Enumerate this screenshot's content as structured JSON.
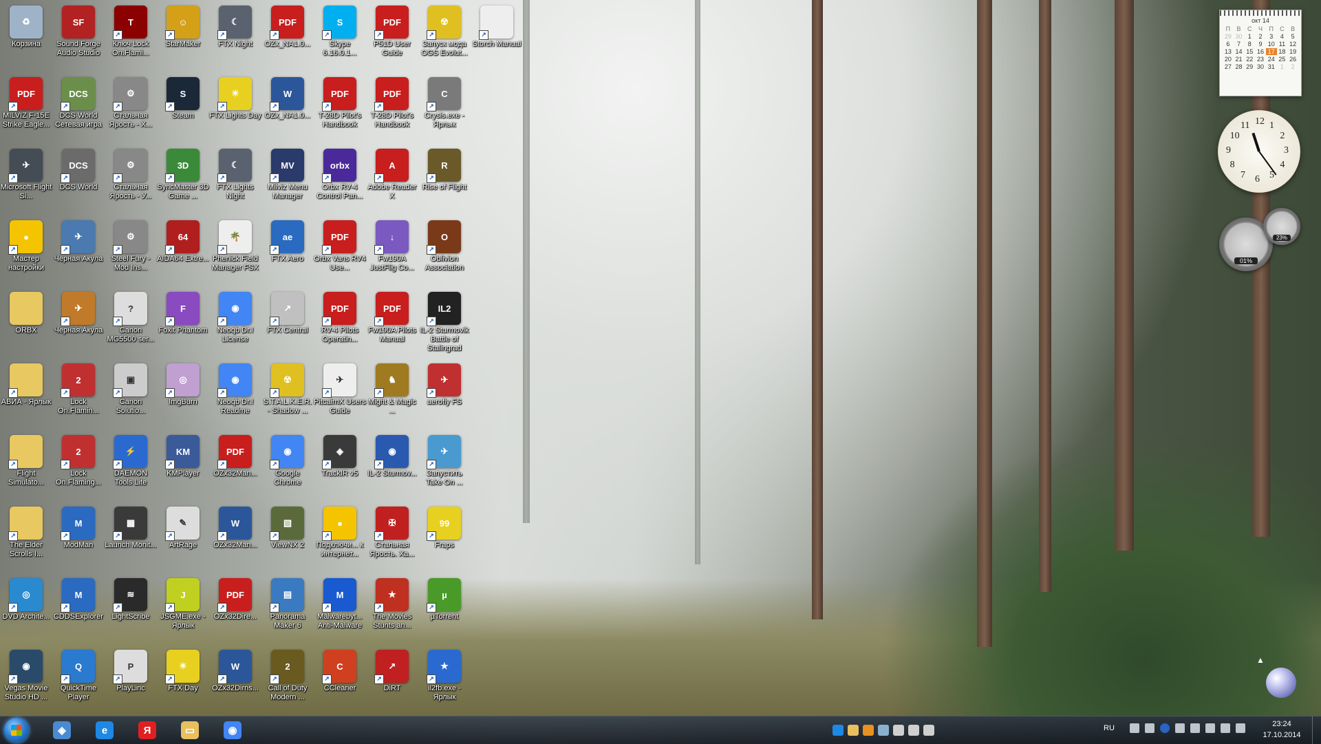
{
  "desktop": {
    "icons": [
      {
        "label": "Корзина",
        "icon": "recycle-bin-icon",
        "color": "#9fb3c8",
        "glyph": "♻",
        "shortcut": false
      },
      {
        "label": "Sound Forge Audio Studio",
        "icon": "sound-forge-icon",
        "color": "#b22222",
        "glyph": "SF",
        "shortcut": false
      },
      {
        "label": "Ключ Lock On.Flami...",
        "icon": "lock-on-icon",
        "color": "#8b0000",
        "glyph": "T",
        "shortcut": true
      },
      {
        "label": "StarMaker",
        "icon": "starmaker-icon",
        "color": "#d4a017",
        "glyph": "☺",
        "shortcut": true
      },
      {
        "label": "FTX Night",
        "icon": "ftx-night-icon",
        "color": "#5a6270",
        "glyph": "☾",
        "shortcut": true
      },
      {
        "label": "OZx_NA1.0...",
        "icon": "pdf-icon",
        "color": "#c81e1e",
        "glyph": "PDF",
        "shortcut": true
      },
      {
        "label": "Skype 6.16.0.1...",
        "icon": "skype-icon",
        "color": "#00aff0",
        "glyph": "S",
        "shortcut": true
      },
      {
        "label": "P51D User Guide",
        "icon": "pdf-icon",
        "color": "#c81e1e",
        "glyph": "PDF",
        "shortcut": true
      },
      {
        "label": "Запуск мода OGS Evolut...",
        "icon": "radiation-icon",
        "color": "#e0c020",
        "glyph": "☢",
        "shortcut": true
      },
      {
        "label": "Storch Manual",
        "icon": "document-icon",
        "color": "#eeeeee",
        "glyph": "",
        "shortcut": true
      },
      {
        "label": "MILVIZ F-15E Strike Eagle...",
        "icon": "pdf-icon",
        "color": "#c81e1e",
        "glyph": "PDF",
        "shortcut": true
      },
      {
        "label": "DCS World Сетевая игра",
        "icon": "dcs-icon",
        "color": "#6b8f4a",
        "glyph": "DCS",
        "shortcut": true
      },
      {
        "label": "Стальная Ярость - Х...",
        "icon": "gear-icon",
        "color": "#888888",
        "glyph": "⚙",
        "shortcut": true
      },
      {
        "label": "Steam",
        "icon": "steam-icon",
        "color": "#1b2838",
        "glyph": "S",
        "shortcut": true
      },
      {
        "label": "FTX Lights Day",
        "icon": "ftx-day-icon",
        "color": "#e8d020",
        "glyph": "☀",
        "shortcut": true
      },
      {
        "label": "OZx_NA1.0...",
        "icon": "word-icon",
        "color": "#2b579a",
        "glyph": "W",
        "shortcut": true
      },
      {
        "label": "T-28D Pilot's Handbook",
        "icon": "pdf-icon",
        "color": "#c81e1e",
        "glyph": "PDF",
        "shortcut": true
      },
      {
        "label": "T-28D Pilot's Handbook",
        "icon": "pdf-icon",
        "color": "#c81e1e",
        "glyph": "PDF",
        "shortcut": true
      },
      {
        "label": "Crysis.exe - Ярлык",
        "icon": "crysis-icon",
        "color": "#7a7a7a",
        "glyph": "C",
        "shortcut": true
      },
      {
        "label": "Microsoft Flight Si...",
        "icon": "airplane-icon",
        "color": "#444c55",
        "glyph": "✈",
        "shortcut": true
      },
      {
        "label": "DCS World",
        "icon": "dcs-icon",
        "color": "#6b6b6b",
        "glyph": "DCS",
        "shortcut": true
      },
      {
        "label": "Стальная Ярость - У...",
        "icon": "gear-icon",
        "color": "#888888",
        "glyph": "⚙",
        "shortcut": true
      },
      {
        "label": "SyncMaster 3D Game ...",
        "icon": "3d-icon",
        "color": "#3a8a3a",
        "glyph": "3D",
        "shortcut": true
      },
      {
        "label": "FTX Lights Night",
        "icon": "ftx-night-icon",
        "color": "#5a6270",
        "glyph": "☾",
        "shortcut": true
      },
      {
        "label": "Milviz Menu Manager",
        "icon": "milviz-icon",
        "color": "#2a3a6a",
        "glyph": "MV",
        "shortcut": true
      },
      {
        "label": "Orbx RV-4 Control Pan...",
        "icon": "orbx-icon",
        "color": "#4a2a9a",
        "glyph": "orbx",
        "shortcut": true
      },
      {
        "label": "Adobe Reader X",
        "icon": "adobe-reader-icon",
        "color": "#c81e1e",
        "glyph": "A",
        "shortcut": true
      },
      {
        "label": "Rise of Flight",
        "icon": "rise-of-flight-icon",
        "color": "#6a5a2a",
        "glyph": "R",
        "shortcut": true
      },
      {
        "label": "Мастер настройки",
        "icon": "beeline-icon",
        "color": "#f5c400",
        "glyph": "●",
        "shortcut": true
      },
      {
        "label": "Черная Акула",
        "icon": "black-shark-icon",
        "color": "#4a7ab0",
        "glyph": "✈",
        "shortcut": true
      },
      {
        "label": "Steel Fury - Mod Ins...",
        "icon": "gear-icon",
        "color": "#888888",
        "glyph": "⚙",
        "shortcut": true
      },
      {
        "label": "AIDA64 Extre...",
        "icon": "aida64-icon",
        "color": "#b01e1e",
        "glyph": "64",
        "shortcut": true
      },
      {
        "label": "Phenick Field Manager FSX",
        "icon": "palm-icon",
        "color": "#eeeeee",
        "glyph": "🌴",
        "shortcut": true
      },
      {
        "label": "FTX Aero",
        "icon": "ftx-aero-icon",
        "color": "#2a6ac0",
        "glyph": "ae",
        "shortcut": true
      },
      {
        "label": "Orbx Vans RV4 Use...",
        "icon": "pdf-icon",
        "color": "#c81e1e",
        "glyph": "PDF",
        "shortcut": true
      },
      {
        "label": "Fw190A JustFlig Co...",
        "icon": "installer-icon",
        "color": "#7a5ac0",
        "glyph": "↓",
        "shortcut": true
      },
      {
        "label": "Oblivion Association",
        "icon": "oblivion-icon",
        "color": "#7a3a1a",
        "glyph": "O",
        "shortcut": true
      },
      {
        "label": "ORBX",
        "icon": "folder-icon",
        "color": "#e8c860",
        "glyph": "",
        "shortcut": false
      },
      {
        "label": "Черная Акула",
        "icon": "black-shark-icon",
        "color": "#c07a2a",
        "glyph": "✈",
        "shortcut": true
      },
      {
        "label": "Canon MG5500 ser...",
        "icon": "help-icon",
        "color": "#dddddd",
        "glyph": "?",
        "shortcut": true
      },
      {
        "label": "Foxit Phantom",
        "icon": "foxit-icon",
        "color": "#8a4ac0",
        "glyph": "F",
        "shortcut": true
      },
      {
        "label": "Neoqb Dr.! License",
        "icon": "chrome-icon",
        "color": "#4285f4",
        "glyph": "◉",
        "shortcut": true
      },
      {
        "label": "FTX Central",
        "icon": "compass-icon",
        "color": "#c0c0c0",
        "glyph": "↗",
        "shortcut": true
      },
      {
        "label": "RV-4 Pilots Operatin...",
        "icon": "pdf-icon",
        "color": "#c81e1e",
        "glyph": "PDF",
        "shortcut": true
      },
      {
        "label": "Fw190A Pilots Manual",
        "icon": "pdf-icon",
        "color": "#c81e1e",
        "glyph": "PDF",
        "shortcut": true
      },
      {
        "label": "IL-2 Sturmovik Battle of Stalingrad",
        "icon": "il2-icon",
        "color": "#222222",
        "glyph": "IL2",
        "shortcut": true
      },
      {
        "label": "АВИА - Ярлык",
        "icon": "folder-icon",
        "color": "#e8c860",
        "glyph": "",
        "shortcut": true
      },
      {
        "label": "Lock On.Flamin...",
        "icon": "lock-on-flaming-icon",
        "color": "#c03030",
        "glyph": "2",
        "shortcut": true
      },
      {
        "label": "Canon Solutio...",
        "icon": "canon-icon",
        "color": "#cccccc",
        "glyph": "▣",
        "shortcut": true
      },
      {
        "label": "ImgBurn",
        "icon": "disc-icon",
        "color": "#c0a0d0",
        "glyph": "◎",
        "shortcut": true
      },
      {
        "label": "Neoqb Dr.! Readme",
        "icon": "chrome-icon",
        "color": "#4285f4",
        "glyph": "◉",
        "shortcut": true
      },
      {
        "label": "S.T.A.L.K.E.R. - Shadow ...",
        "icon": "radiation-icon",
        "color": "#e0c020",
        "glyph": "☢",
        "shortcut": true
      },
      {
        "label": "PitcairnX Users Guide",
        "icon": "document-icon",
        "color": "#eeeeee",
        "glyph": "✈",
        "shortcut": true
      },
      {
        "label": "Might & Magic ...",
        "icon": "griffin-icon",
        "color": "#a07a20",
        "glyph": "♞",
        "shortcut": true
      },
      {
        "label": "aerofly FS",
        "icon": "biplane-icon",
        "color": "#c03030",
        "glyph": "✈",
        "shortcut": true
      },
      {
        "label": "Flight Simulato...",
        "icon": "folder-icon",
        "color": "#e8c860",
        "glyph": "",
        "shortcut": true
      },
      {
        "label": "Lock On.Flaming...",
        "icon": "lock-on-flaming-icon",
        "color": "#c03030",
        "glyph": "2",
        "shortcut": true
      },
      {
        "label": "DAEMON Tools Lite",
        "icon": "daemon-tools-icon",
        "color": "#2a6ad0",
        "glyph": "⚡",
        "shortcut": true
      },
      {
        "label": "KMPlayer",
        "icon": "kmplayer-icon",
        "color": "#3a5a9a",
        "glyph": "KM",
        "shortcut": true
      },
      {
        "label": "OZx32Man...",
        "icon": "pdf-icon",
        "color": "#c81e1e",
        "glyph": "PDF",
        "shortcut": true
      },
      {
        "label": "Google Chrome",
        "icon": "chrome-icon",
        "color": "#4285f4",
        "glyph": "◉",
        "shortcut": true
      },
      {
        "label": "TrackIR v5",
        "icon": "trackir-icon",
        "color": "#3a3a3a",
        "glyph": "◈",
        "shortcut": true
      },
      {
        "label": "IL-2 Sturmov...",
        "icon": "roundel-icon",
        "color": "#2a5ab0",
        "glyph": "◉",
        "shortcut": true
      },
      {
        "label": "Запустить Take On ...",
        "icon": "take-on-icon",
        "color": "#4a9ad0",
        "glyph": "✈",
        "shortcut": true
      },
      {
        "label": "The Elder Scrolls I...",
        "icon": "folder-icon",
        "color": "#e8c860",
        "glyph": "",
        "shortcut": true
      },
      {
        "label": "ModMan",
        "icon": "modman-icon",
        "color": "#2a6ac0",
        "glyph": "M",
        "shortcut": true
      },
      {
        "label": "Launch Monit...",
        "icon": "launch-monitor-icon",
        "color": "#3a3a3a",
        "glyph": "▦",
        "shortcut": true
      },
      {
        "label": "ArtRage",
        "icon": "artrage-icon",
        "color": "#dddddd",
        "glyph": "✎",
        "shortcut": true
      },
      {
        "label": "OZx32Man...",
        "icon": "word-icon",
        "color": "#2b579a",
        "glyph": "W",
        "shortcut": true
      },
      {
        "label": "ViewNX 2",
        "icon": "viewnx-icon",
        "color": "#5a6a3a",
        "glyph": "▧",
        "shortcut": true
      },
      {
        "label": "Подключи... к интернет...",
        "icon": "beeline-icon",
        "color": "#f5c400",
        "glyph": "●",
        "shortcut": true
      },
      {
        "label": "Стальная Ярость. Ха...",
        "icon": "steel-fury-icon",
        "color": "#c02020",
        "glyph": "✠",
        "shortcut": true
      },
      {
        "label": "Fraps",
        "icon": "fraps-icon",
        "color": "#e8d020",
        "glyph": "99",
        "shortcut": true
      },
      {
        "label": "DVD Archite...",
        "icon": "dvd-icon",
        "color": "#2a8ad0",
        "glyph": "◎",
        "shortcut": true
      },
      {
        "label": "CDDSExplorer",
        "icon": "modman-icon",
        "color": "#2a6ac0",
        "glyph": "M",
        "shortcut": true
      },
      {
        "label": "LightScribe",
        "icon": "lightscribe-icon",
        "color": "#2a2a2a",
        "glyph": "≋",
        "shortcut": true
      },
      {
        "label": "JSGME.exe - Ярлык",
        "icon": "jsgme-icon",
        "color": "#c0d020",
        "glyph": "J",
        "shortcut": true
      },
      {
        "label": "OZx32Dire...",
        "icon": "pdf-icon",
        "color": "#c81e1e",
        "glyph": "PDF",
        "shortcut": true
      },
      {
        "label": "Panorama Maker 6",
        "icon": "panorama-icon",
        "color": "#3a7ac0",
        "glyph": "▤",
        "shortcut": true
      },
      {
        "label": "Malwarebyt... Anti-Malware",
        "icon": "malwarebytes-icon",
        "color": "#1a5ad0",
        "glyph": "M",
        "shortcut": true
      },
      {
        "label": "The Movies Stunts an...",
        "icon": "movies-icon",
        "color": "#c03020",
        "glyph": "★",
        "shortcut": true
      },
      {
        "label": "µTorrent",
        "icon": "utorrent-icon",
        "color": "#4a9a2a",
        "glyph": "µ",
        "shortcut": true
      },
      {
        "label": "Vegas Movie Studio HD ...",
        "icon": "vegas-icon",
        "color": "#2a4a6a",
        "glyph": "◉",
        "shortcut": true
      },
      {
        "label": "QuickTime Player",
        "icon": "quicktime-icon",
        "color": "#2a7ad0",
        "glyph": "Q",
        "shortcut": true
      },
      {
        "label": "PlayLinc",
        "icon": "playlinc-icon",
        "color": "#dddddd",
        "glyph": "P",
        "shortcut": true
      },
      {
        "label": "FTX Day",
        "icon": "ftx-day-icon",
        "color": "#e8d020",
        "glyph": "☀",
        "shortcut": true
      },
      {
        "label": "OZx32Dirns...",
        "icon": "word-icon",
        "color": "#2b579a",
        "glyph": "W",
        "shortcut": true
      },
      {
        "label": "Call of Duty Modern ...",
        "icon": "cod-icon",
        "color": "#6a5a20",
        "glyph": "2",
        "shortcut": true
      },
      {
        "label": "CCleaner",
        "icon": "ccleaner-icon",
        "color": "#d04020",
        "glyph": "C",
        "shortcut": true
      },
      {
        "label": "DiRT",
        "icon": "dirt-icon",
        "color": "#c02020",
        "glyph": "↗",
        "shortcut": true
      },
      {
        "label": "il2fb.exe - Ярлык",
        "icon": "star-icon",
        "color": "#2a6ad0",
        "glyph": "★",
        "shortcut": true
      }
    ]
  },
  "gadgets": {
    "calendar": {
      "month": "окт 14",
      "weekdays": [
        "П",
        "В",
        "С",
        "Ч",
        "П",
        "С",
        "В"
      ],
      "days": [
        "29",
        "30",
        "1",
        "2",
        "3",
        "4",
        "5",
        "6",
        "7",
        "8",
        "9",
        "10",
        "11",
        "12",
        "13",
        "14",
        "15",
        "16",
        "17",
        "18",
        "19",
        "20",
        "21",
        "22",
        "23",
        "24",
        "25",
        "26",
        "27",
        "28",
        "29",
        "30",
        "31",
        "1",
        "2"
      ],
      "today": "17",
      "dim_days": [
        "29",
        "30",
        "1",
        "2"
      ]
    },
    "clock": {
      "numbers": [
        "12",
        "1",
        "2",
        "3",
        "4",
        "5",
        "6",
        "7",
        "8",
        "9",
        "10",
        "11"
      ],
      "time": "11:24"
    },
    "cpu_meter": {
      "cpu": "01%",
      "ram": "23%"
    }
  },
  "taskbar": {
    "pinned": [
      {
        "name": "explorer-icon",
        "color": "#4a8ad0",
        "glyph": "◈"
      },
      {
        "name": "internet-explorer-icon",
        "color": "#1e88e5",
        "glyph": "e"
      },
      {
        "name": "yandex-icon",
        "color": "#e02020",
        "glyph": "Я"
      },
      {
        "name": "file-manager-icon",
        "color": "#e8c060",
        "glyph": "▭"
      },
      {
        "name": "chrome-icon",
        "color": "#4285f4",
        "glyph": "◉"
      }
    ],
    "language": "RU",
    "time": "23:24",
    "date": "17.10.2014"
  }
}
